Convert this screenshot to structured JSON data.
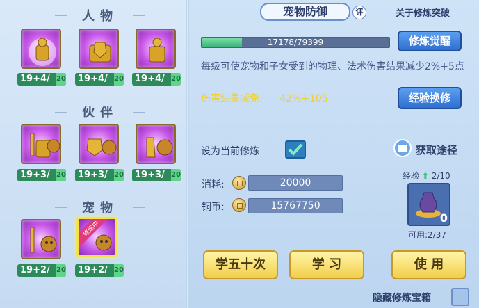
{
  "left": {
    "sections": [
      {
        "title": "人物",
        "items": [
          {
            "level": "19+4/",
            "level_suffix": "20"
          },
          {
            "level": "19+4/",
            "level_suffix": "20"
          },
          {
            "level": "19+4/",
            "level_suffix": "20"
          }
        ]
      },
      {
        "title": "伙伴",
        "items": [
          {
            "level": "19+3/",
            "level_suffix": "20"
          },
          {
            "level": "19+3/",
            "level_suffix": "20"
          },
          {
            "level": "19+3/",
            "level_suffix": "20"
          }
        ]
      },
      {
        "title": "宠物",
        "items": [
          {
            "level": "19+2/",
            "level_suffix": "20"
          },
          {
            "level": "19+2/",
            "level_suffix": "20",
            "tag": "修炼中"
          }
        ]
      }
    ]
  },
  "right": {
    "title": "宠物防御",
    "eval_badge": "评",
    "breakthrough_link": "关于修炼突破",
    "progress": {
      "text": "17178/79399",
      "current": 17178,
      "max": 79399
    },
    "awaken_btn": "修炼觉醒",
    "description": "每级可使宠物和子女受到的物理、法术伤害结果减少2%+5点",
    "effect_label": "伤害结果减免:",
    "effect_value": "42%+105",
    "exchange_btn": "经验换修",
    "set_current_label": "设为当前修炼",
    "set_current_checked": true,
    "obtain_label": "获取途径",
    "cost_label": "消耗:",
    "cost_value": "20000",
    "copper_label": "铜币:",
    "copper_value": "15767750",
    "exp_label": "经验",
    "exp_count": "2/10",
    "item_count": "0",
    "usable_label": "可用:2/37",
    "btn_learn50": "学五十次",
    "btn_learn": "学 习",
    "btn_use": "使 用",
    "hide_box_label": "隐藏修炼宝箱"
  }
}
